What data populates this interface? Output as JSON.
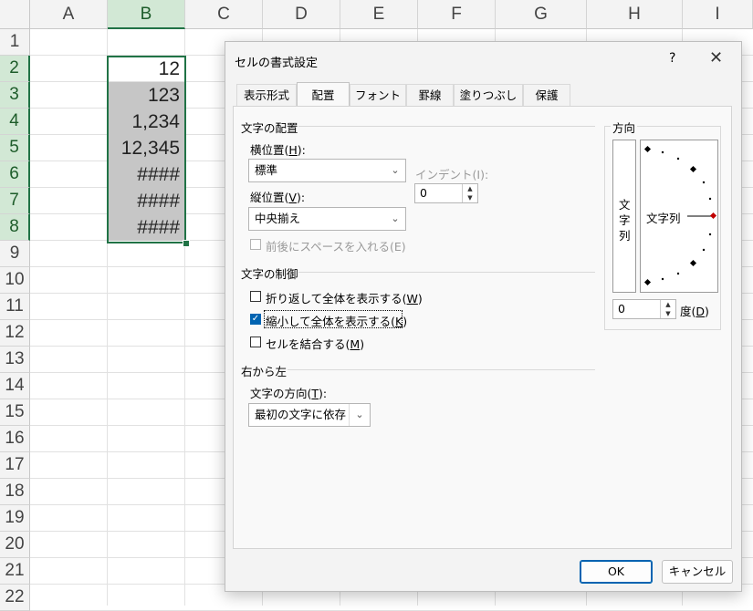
{
  "sheet": {
    "columns": [
      "A",
      "B",
      "C",
      "D",
      "E",
      "F",
      "G",
      "H",
      "I"
    ],
    "rows": [
      "1",
      "2",
      "3",
      "4",
      "5",
      "6",
      "7",
      "8",
      "9",
      "10",
      "11",
      "12",
      "13",
      "14",
      "15",
      "16",
      "17",
      "18",
      "19",
      "20",
      "21",
      "22"
    ],
    "cells_B": [
      "12",
      "123",
      "1,234",
      "12,345",
      "####",
      "####",
      "####"
    ]
  },
  "dialog": {
    "title": "セルの書式設定",
    "help": "?",
    "close": "✕",
    "tabs": [
      "表示形式",
      "配置",
      "フォント",
      "罫線",
      "塗りつぶし",
      "保護"
    ],
    "alignment_section": "文字の配置",
    "horizontal_label_pre": "横位置(",
    "horizontal_key": "H",
    "horizontal_label_post": "):",
    "horizontal_value": "標準",
    "indent_label": "インデント(I):",
    "indent_value": "0",
    "vertical_label_pre": "縦位置(",
    "vertical_key": "V",
    "vertical_label_post": "):",
    "vertical_value": "中央揃え",
    "justify_distributed": "前後にスペースを入れる(E)",
    "control_section": "文字の制御",
    "wrap_pre": "折り返して全体を表示する(",
    "wrap_key": "W",
    "shrink_pre": "縮小して全体を表示する(",
    "shrink_key": "K",
    "merge_pre": "セルを結合する(",
    "merge_key": "M",
    "close_paren": ")",
    "rtl_section": "右から左",
    "direction_label_pre": "文字の方向(",
    "direction_key": "T",
    "direction_label_post": "):",
    "direction_value": "最初の文字に依存",
    "orientation_section": "方向",
    "vertical_text": [
      "文",
      "字",
      "列"
    ],
    "orientation_text": "文字列",
    "degree_value": "0",
    "degree_label_pre": "度(",
    "degree_key": "D",
    "ok": "OK",
    "cancel": "キャンセル"
  },
  "colors": {
    "selection_green": "#217346",
    "checkbox_blue": "#0063b1",
    "cell_shade": "#c6c6c6"
  }
}
